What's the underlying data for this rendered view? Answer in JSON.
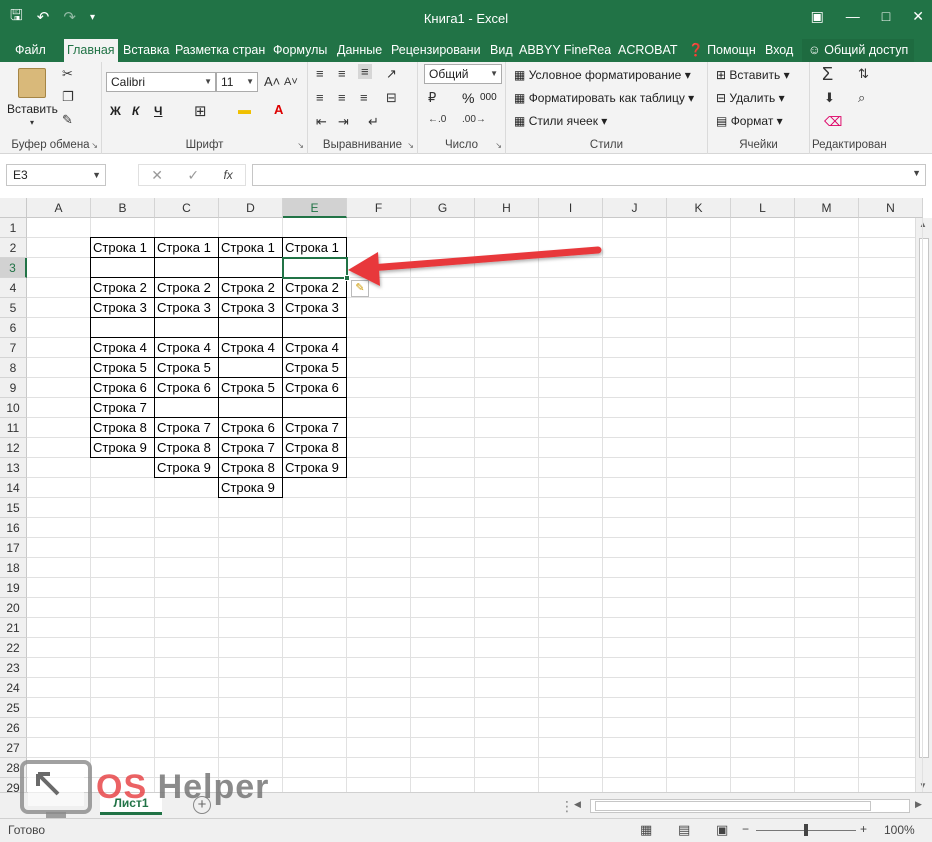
{
  "title_bar": {
    "title": "Книга1 - Excel",
    "icons": [
      "save-icon",
      "undo-icon",
      "redo-icon",
      "customize-qat-icon"
    ]
  },
  "ribbon_tabs": [
    "Файл",
    "Главная",
    "Вставка",
    "Разметка страни",
    "Формулы",
    "Данные",
    "Рецензировани",
    "Вид",
    "ABBYY FineRead",
    "ACROBAT",
    "Помощн",
    "Вход",
    "Общий доступ"
  ],
  "ribbon": {
    "clipboard": {
      "paste": "Вставить",
      "label": "Буфер обмена"
    },
    "font": {
      "name": "Calibri",
      "size": "11",
      "bold": "Ж",
      "italic": "К",
      "underline": "Ч",
      "label": "Шрифт"
    },
    "alignment": {
      "label": "Выравнивание"
    },
    "number": {
      "format": "Общий",
      "percent": "%",
      "thousands": "000",
      "label": "Число"
    },
    "styles": {
      "conditional": "Условное форматирование",
      "as_table": "Форматировать как таблицу",
      "cell_styles": "Стили ячеек",
      "label": "Стили"
    },
    "cells": {
      "insert": "Вставить",
      "delete": "Удалить",
      "format": "Формат",
      "label": "Ячейки"
    },
    "editing": {
      "label": "Редактирован"
    }
  },
  "formula_bar": {
    "name_box": "E3",
    "fx": "fx",
    "content": ""
  },
  "columns": [
    "A",
    "B",
    "C",
    "D",
    "E",
    "F",
    "G",
    "H",
    "I",
    "J",
    "K",
    "L",
    "M",
    "N"
  ],
  "rows": [
    "1",
    "2",
    "3",
    "4",
    "5",
    "6",
    "7",
    "8",
    "9",
    "10",
    "11",
    "12",
    "13",
    "14",
    "15",
    "16",
    "17",
    "18",
    "19",
    "20",
    "21",
    "22",
    "23",
    "24",
    "25",
    "26",
    "27",
    "28",
    "29"
  ],
  "selected_cell": "E3",
  "cells": [
    {
      "ref": "B2",
      "value": "Строка 1"
    },
    {
      "ref": "C2",
      "value": "Строка 1"
    },
    {
      "ref": "D2",
      "value": "Строка 1"
    },
    {
      "ref": "E2",
      "value": "Строка 1"
    },
    {
      "ref": "B4",
      "value": "Строка 2"
    },
    {
      "ref": "C4",
      "value": "Строка 2"
    },
    {
      "ref": "D4",
      "value": "Строка 2"
    },
    {
      "ref": "E4",
      "value": "Строка 2"
    },
    {
      "ref": "B5",
      "value": "Строка 3"
    },
    {
      "ref": "C5",
      "value": "Строка 3"
    },
    {
      "ref": "D5",
      "value": "Строка 3"
    },
    {
      "ref": "E5",
      "value": "Строка 3"
    },
    {
      "ref": "B7",
      "value": "Строка 4"
    },
    {
      "ref": "C7",
      "value": "Строка 4"
    },
    {
      "ref": "D7",
      "value": "Строка 4"
    },
    {
      "ref": "E7",
      "value": "Строка 4"
    },
    {
      "ref": "B8",
      "value": "Строка 5"
    },
    {
      "ref": "C8",
      "value": "Строка 5"
    },
    {
      "ref": "E8",
      "value": "Строка 5"
    },
    {
      "ref": "B9",
      "value": "Строка 6"
    },
    {
      "ref": "C9",
      "value": "Строка 6"
    },
    {
      "ref": "D9",
      "value": "Строка 5"
    },
    {
      "ref": "E9",
      "value": "Строка 6"
    },
    {
      "ref": "B10",
      "value": "Строка 7"
    },
    {
      "ref": "B11",
      "value": "Строка 8"
    },
    {
      "ref": "C11",
      "value": "Строка 7"
    },
    {
      "ref": "D11",
      "value": "Строка 6"
    },
    {
      "ref": "E11",
      "value": "Строка 7"
    },
    {
      "ref": "B12",
      "value": "Строка 9"
    },
    {
      "ref": "C12",
      "value": "Строка 8"
    },
    {
      "ref": "D12",
      "value": "Строка 7"
    },
    {
      "ref": "E12",
      "value": "Строка 8"
    },
    {
      "ref": "C13",
      "value": "Строка 9"
    },
    {
      "ref": "D13",
      "value": "Строка 8"
    },
    {
      "ref": "E13",
      "value": "Строка 9"
    },
    {
      "ref": "D14",
      "value": "Строка 9"
    }
  ],
  "bordered_ranges": [
    {
      "col": "B",
      "from": 2,
      "to": 12
    },
    {
      "col": "C",
      "from": 2,
      "to": 13
    },
    {
      "col": "D",
      "from": 2,
      "to": 14
    },
    {
      "col": "E",
      "from": 2,
      "to": 13
    }
  ],
  "sheet_tabs": [
    "Лист1"
  ],
  "status_bar": {
    "status": "Готово",
    "zoom": "100%"
  },
  "watermark": {
    "text": "OS Helper"
  },
  "annotation": {
    "type": "red-arrow",
    "target": "E3"
  },
  "accent_color": "#217346",
  "arrow_color": "#e8383b"
}
